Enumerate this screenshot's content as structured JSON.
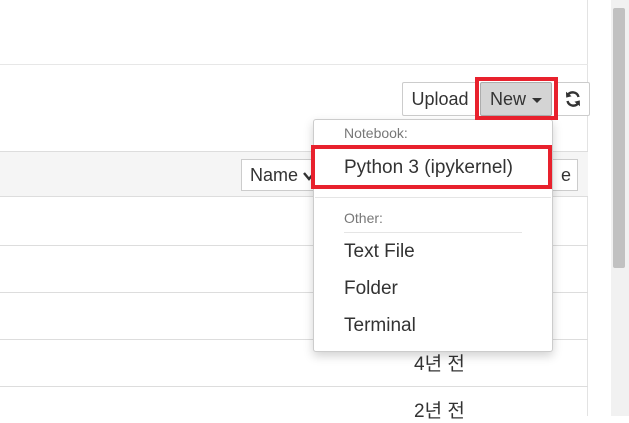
{
  "toolbar": {
    "upload_label": "Upload",
    "new_label": "New",
    "refresh_icon": "refresh-icon"
  },
  "list_header": {
    "sort_name_label": "Name",
    "sort_other_label": "e"
  },
  "rows": [
    {
      "time": "4년 전"
    },
    {
      "time": "2년 전"
    }
  ],
  "new_menu": {
    "notebook_header": "Notebook:",
    "python_kernel": "Python 3 (ipykernel)",
    "other_header": "Other:",
    "items": [
      "Text File",
      "Folder",
      "Terminal"
    ]
  },
  "colors": {
    "highlight": "#e8212d",
    "new_button_active": "#d4d4d4"
  }
}
